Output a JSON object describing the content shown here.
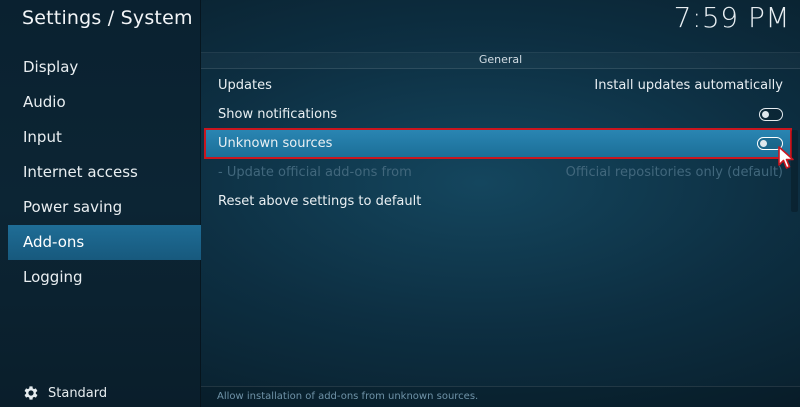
{
  "header": {
    "title": "Settings / System",
    "clock": "7:59 PM"
  },
  "sidebar": {
    "items": [
      {
        "label": "Display"
      },
      {
        "label": "Audio"
      },
      {
        "label": "Input"
      },
      {
        "label": "Internet access"
      },
      {
        "label": "Power saving"
      },
      {
        "label": "Add-ons",
        "active": true
      },
      {
        "label": "Logging"
      }
    ],
    "footer": {
      "label": "Standard",
      "icon": "gear-icon"
    }
  },
  "main": {
    "group_title": "General",
    "rows": [
      {
        "label": "Updates",
        "value": "Install updates automatically"
      },
      {
        "label": "Show notifications",
        "control": "toggle-off"
      },
      {
        "label": "Unknown sources",
        "control": "toggle-off",
        "selected": true
      },
      {
        "label": "- Update official add-ons from",
        "value": "Official repositories only (default)",
        "disabled": true
      },
      {
        "label": "Reset above settings to default"
      }
    ],
    "hint": "Allow installation of add-ons from unknown sources."
  },
  "colors": {
    "accent": "#1f6d96",
    "selected_row": "#2a86b3",
    "highlight_outline": "#c9161f",
    "disabled_text": "#41677c"
  }
}
